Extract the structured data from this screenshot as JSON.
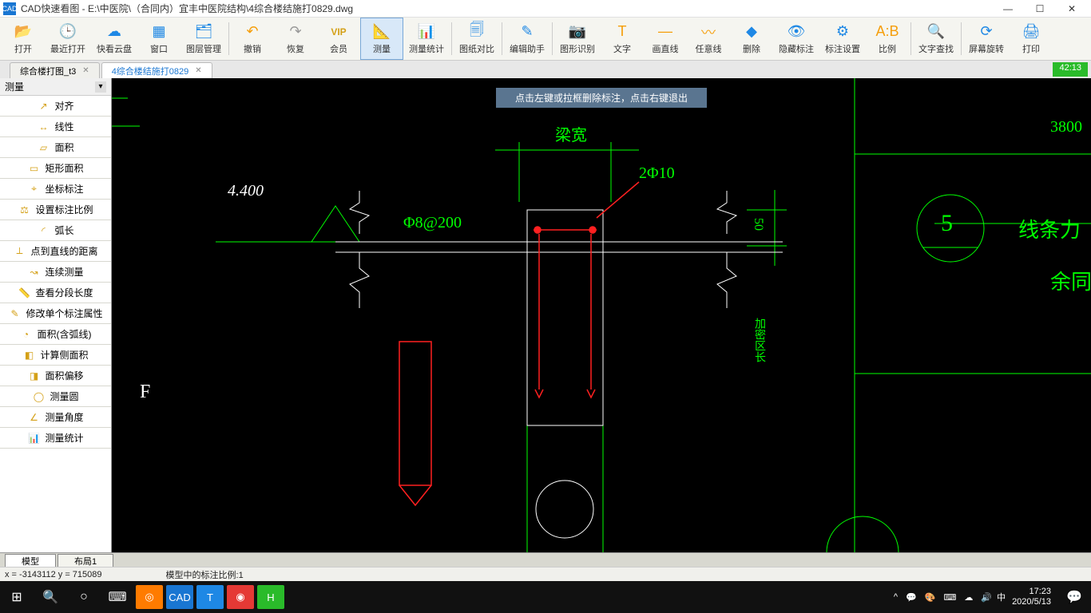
{
  "title": "CAD快速看图 - E:\\中医院\\（合同内）宜丰中医院结构\\4综合楼结施打0829.dwg",
  "app_icon": "CAD",
  "win": {
    "min": "—",
    "max": "☐",
    "close": "✕"
  },
  "toolbar": [
    {
      "lbl": "打开"
    },
    {
      "lbl": "最近打开"
    },
    {
      "lbl": "快看云盘"
    },
    {
      "lbl": "窗口"
    },
    {
      "lbl": "图层管理"
    },
    {
      "sep": true
    },
    {
      "lbl": "撤销"
    },
    {
      "lbl": "恢复"
    },
    {
      "lbl": "会员"
    },
    {
      "lbl": "测量",
      "active": true
    },
    {
      "lbl": "测量统计"
    },
    {
      "sep": true
    },
    {
      "lbl": "图纸对比"
    },
    {
      "sep": true
    },
    {
      "lbl": "编辑助手"
    },
    {
      "sep": true
    },
    {
      "lbl": "图形识别"
    },
    {
      "lbl": "文字"
    },
    {
      "lbl": "画直线"
    },
    {
      "lbl": "任意线"
    },
    {
      "lbl": "删除"
    },
    {
      "lbl": "隐藏标注"
    },
    {
      "lbl": "标注设置"
    },
    {
      "lbl": "比例"
    },
    {
      "sep": true
    },
    {
      "lbl": "文字查找"
    },
    {
      "sep": true
    },
    {
      "lbl": "屏幕旋转"
    },
    {
      "lbl": "打印"
    }
  ],
  "tb_icons": [
    "📂",
    "🕒",
    "☁",
    "▦",
    "🗂",
    "↶",
    "↷",
    "VIP",
    "📐",
    "📊",
    "🗐",
    "✎",
    "📷",
    "T",
    "—",
    "〰",
    "◆",
    "👁",
    "⚙",
    "A:B",
    "🔍",
    "⟳",
    "🖨"
  ],
  "tabs": [
    {
      "label": "综合楼打图_t3",
      "active": false
    },
    {
      "label": "4综合楼结施打0829",
      "active": true
    }
  ],
  "timer": "42:13",
  "side": {
    "title": "测量",
    "items": [
      "对齐",
      "线性",
      "面积",
      "矩形面积",
      "坐标标注",
      "设置标注比例",
      "弧长",
      "点到直线的距离",
      "连续测量",
      "查看分段长度",
      "修改单个标注属性",
      "面积(含弧线)",
      "计算侧面积",
      "面积偏移",
      "测量圆",
      "测量角度",
      "测量统计"
    ],
    "icons": [
      "↗",
      "↔",
      "▱",
      "▭",
      "⌖",
      "⚖",
      "◜",
      "⟂",
      "↝",
      "📏",
      "✎",
      "◔",
      "◧",
      "◨",
      "◯",
      "∠",
      "📊"
    ]
  },
  "hint": "点击左键或拉框删除标注，点击右键退出",
  "dwg": {
    "t1": "梁宽",
    "t2": "2Φ10",
    "t3": "Φ8@200",
    "t4": "4.400",
    "t5": "50",
    "t6": "3800",
    "t7": "线条力",
    "t8": "余同",
    "t9": "5",
    "t10": "F",
    "t11": "加密区长"
  },
  "bottom_tabs": [
    {
      "label": "模型",
      "active": true
    },
    {
      "label": "布局1",
      "active": false
    }
  ],
  "status": {
    "coords": "x = -3143112  y = 715089",
    "scale": "模型中的标注比例:1"
  },
  "taskbar": {
    "icons": [
      "⊞",
      "🔍",
      "○",
      "⌨"
    ],
    "apps": [
      "◎",
      "CAD",
      "T",
      "◉",
      "H"
    ],
    "tray": [
      "^",
      "💬",
      "🎨",
      "⌨",
      "☁",
      "🔊"
    ],
    "ime": "中",
    "time": "17:23",
    "date": "2020/5/13",
    "notif": "💬"
  }
}
